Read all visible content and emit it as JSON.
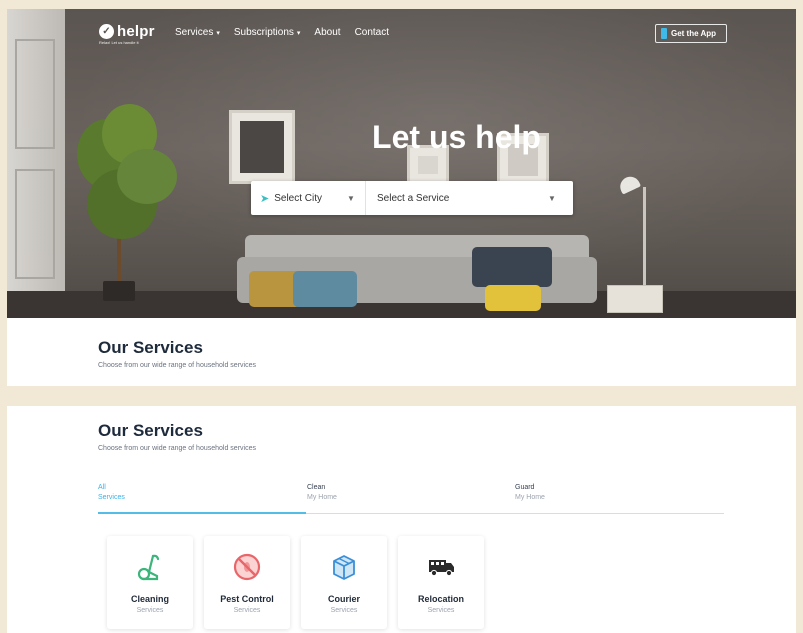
{
  "brand": {
    "name": "helpr",
    "tagline": "Relax! Let us handle it"
  },
  "nav": {
    "items": [
      {
        "label": "Services",
        "dropdown": true
      },
      {
        "label": "Subscriptions",
        "dropdown": true
      },
      {
        "label": "About",
        "dropdown": false
      },
      {
        "label": "Contact",
        "dropdown": false
      }
    ],
    "app_button": "Get the App"
  },
  "hero": {
    "title": "Let us help",
    "city_placeholder": "Select City",
    "service_placeholder": "Select a Service"
  },
  "services_section": {
    "title": "Our Services",
    "subtitle": "Choose from our wide range of household services"
  },
  "tabs": [
    {
      "line1": "All",
      "line2": "Services",
      "active": true
    },
    {
      "line1": "Clean",
      "line2": "My Home",
      "active": false
    },
    {
      "line1": "Guard",
      "line2": "My Home",
      "active": false
    }
  ],
  "cards": [
    {
      "name": "Cleaning",
      "sub": "Services",
      "icon": "vacuum-icon"
    },
    {
      "name": "Pest Control",
      "sub": "Services",
      "icon": "no-pest-icon"
    },
    {
      "name": "Courier",
      "sub": "Services",
      "icon": "box-icon"
    },
    {
      "name": "Relocation",
      "sub": "Services",
      "icon": "truck-icon"
    }
  ],
  "colors": {
    "accent": "#3fb0e8",
    "heading": "#1e2b3c",
    "icon_green": "#3bb57a",
    "icon_red": "#e8666a",
    "icon_blue": "#3a8fd8"
  }
}
